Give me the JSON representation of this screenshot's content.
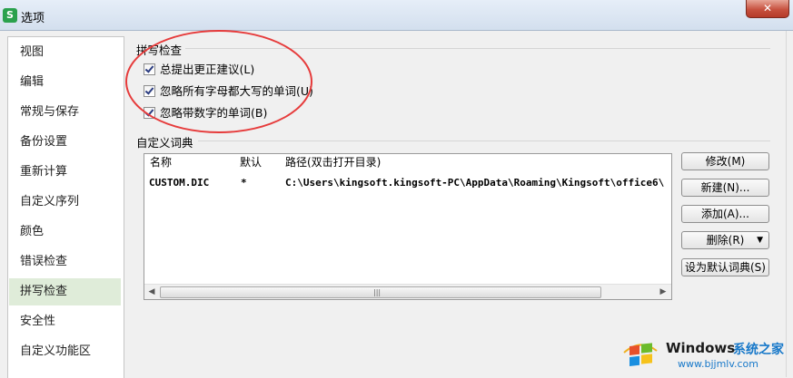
{
  "window": {
    "title": "选项",
    "app_icon": "S",
    "close_symbol": "✕"
  },
  "sidebar": {
    "items": [
      {
        "label": "视图"
      },
      {
        "label": "编辑"
      },
      {
        "label": "常规与保存"
      },
      {
        "label": "备份设置"
      },
      {
        "label": "重新计算"
      },
      {
        "label": "自定义序列"
      },
      {
        "label": "颜色"
      },
      {
        "label": "错误检查"
      },
      {
        "label": "拼写检查",
        "selected": true
      },
      {
        "label": "安全性"
      },
      {
        "label": "自定义功能区"
      }
    ]
  },
  "spellcheck": {
    "section_title": "拼写检查",
    "options": [
      {
        "label": "总提出更正建议(L)",
        "checked": true
      },
      {
        "label": "忽略所有字母都大写的单词(U)",
        "checked": true
      },
      {
        "label": "忽略带数字的单词(B)",
        "checked": true
      }
    ]
  },
  "dictionary": {
    "section_title": "自定义词典",
    "columns": [
      "名称",
      "默认",
      "路径(双击打开目录)"
    ],
    "rows": [
      {
        "name": "CUSTOM.DIC",
        "default": "*",
        "path": "C:\\Users\\kingsoft.kingsoft-PC\\AppData\\Roaming\\Kingsoft\\office6\\"
      }
    ],
    "buttons": {
      "modify": "修改(M)",
      "new": "新建(N)...",
      "add": "添加(A)...",
      "delete": "删除(R)",
      "set_default": "设为默认词典(S)"
    }
  },
  "watermark": {
    "brand": "Windows",
    "cn": "系统之家",
    "url": "www.bjjmlv.com"
  },
  "colors": {
    "selected_nav": "#dfecd9",
    "annotation": "#e63b3b",
    "watermark_blue": "#1778c9"
  }
}
